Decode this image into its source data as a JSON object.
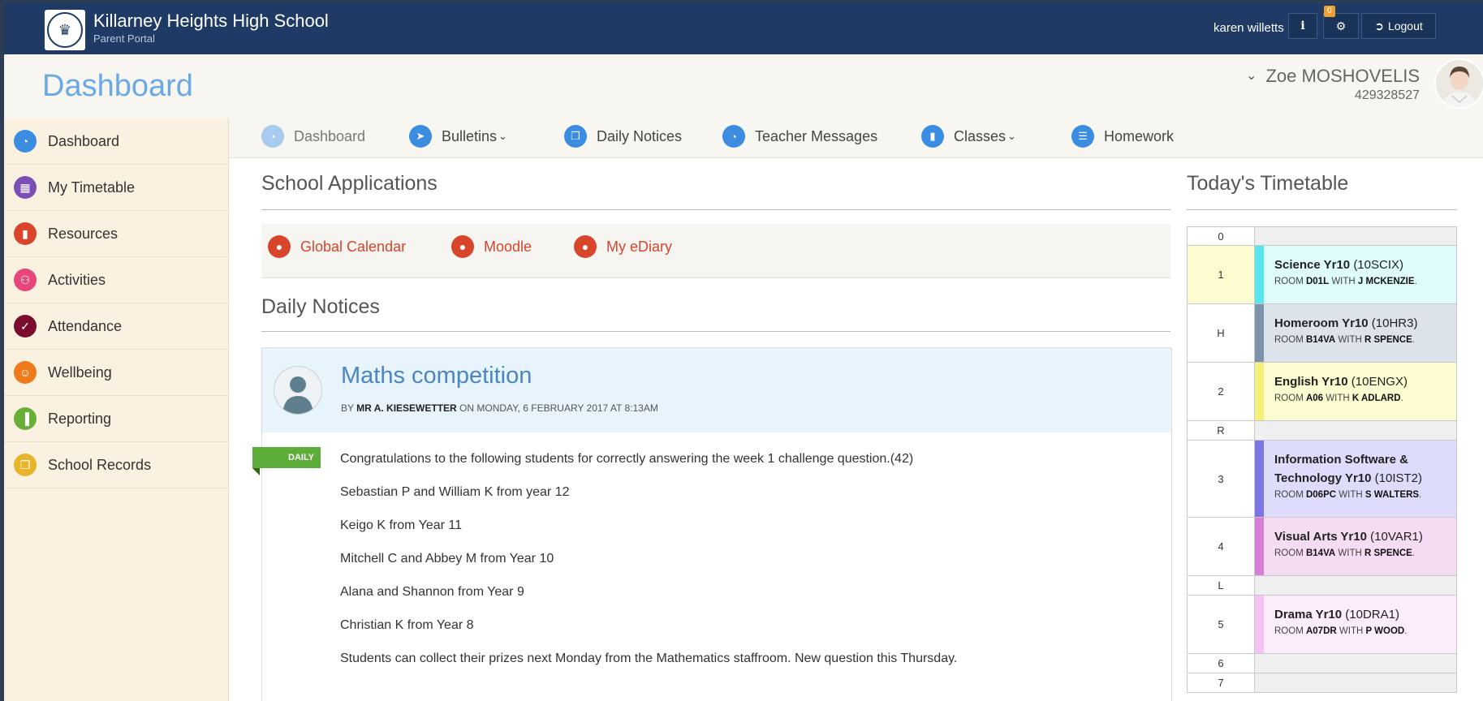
{
  "school": {
    "name": "Killarney Heights High School",
    "portal": "Parent Portal"
  },
  "topbar": {
    "user": "karen willetts",
    "info_icon": "i",
    "gear_badge": "0",
    "logout_label": "Logout"
  },
  "header": {
    "title": "Dashboard",
    "student_name": "Zoe MOSHOVELIS",
    "student_id": "429328527"
  },
  "sidebar": {
    "items": [
      {
        "label": "Dashboard",
        "icon": "dashboard-icon",
        "color": "#3a8de0"
      },
      {
        "label": "My Timetable",
        "icon": "calendar-icon",
        "color": "#7a4fb5"
      },
      {
        "label": "Resources",
        "icon": "book-icon",
        "color": "#d9452a"
      },
      {
        "label": "Activities",
        "icon": "bicycle-icon",
        "color": "#e8457a"
      },
      {
        "label": "Attendance",
        "icon": "check-icon",
        "color": "#7a0d2e"
      },
      {
        "label": "Wellbeing",
        "icon": "smile-icon",
        "color": "#f07a1a"
      },
      {
        "label": "Reporting",
        "icon": "bar-chart-icon",
        "color": "#6aae3a"
      },
      {
        "label": "School Records",
        "icon": "files-icon",
        "color": "#e8b52a"
      }
    ]
  },
  "nav": {
    "dashboard": "Dashboard",
    "bulletins": "Bulletins",
    "daily_notices": "Daily Notices",
    "teacher_messages": "Teacher Messages",
    "classes": "Classes",
    "homework": "Homework"
  },
  "main": {
    "apps_title": "School Applications",
    "apps": [
      "Global Calendar",
      "Moodle",
      "My eDiary"
    ],
    "notices_title": "Daily Notices"
  },
  "notice": {
    "title": "Maths competition",
    "by": "BY",
    "author": "MR A. KIESEWETTER",
    "date": "ON MONDAY, 6 FEBRUARY 2017 AT 8:13AM",
    "tag": "DAILY",
    "lines": [
      "Congratulations to the following students for correctly answering the week 1 challenge question.(42)",
      "Sebastian P and William K from year 12",
      "Keigo K from Year 11",
      "Mitchell C and Abbey M from Year 10",
      "Alana and Shannon from Year 9",
      "Christian K from Year 8",
      "Students can collect their prizes next Monday from the Mathematics staffroom. New question this Thursday."
    ]
  },
  "timetable": {
    "title": "Today's Timetable",
    "room_word": "ROOM",
    "with_word": "WITH",
    "rows": [
      {
        "period": "0",
        "empty": true
      },
      {
        "period": "1",
        "subject": "Science Yr10",
        "code": "(10SCIX)",
        "room": "D01L",
        "teacher": "J MCKENZIE",
        "bg": "#dffcfd",
        "strip": "#5ae6ef",
        "pbg": "#fdfbd0"
      },
      {
        "period": "H",
        "subject": "Homeroom Yr10",
        "code": "(10HR3)",
        "room": "B14VA",
        "teacher": "R SPENCE",
        "bg": "#dde3ea",
        "strip": "#7d93ab",
        "pbg": "#ffffff"
      },
      {
        "period": "2",
        "subject": "English Yr10",
        "code": "(10ENGX)",
        "room": "A06",
        "teacher": "K ADLARD",
        "bg": "#fdfbd0",
        "strip": "#f5f07a",
        "pbg": "#ffffff"
      },
      {
        "period": "R",
        "empty": true
      },
      {
        "period": "3",
        "subject": "Information Software & Technology Yr10",
        "code": "(10IST2)",
        "room": "D06PC",
        "teacher": "S WALTERS",
        "bg": "#dedcfb",
        "strip": "#7b75e6",
        "pbg": "#ffffff"
      },
      {
        "period": "4",
        "subject": "Visual Arts Yr10",
        "code": "(10VAR1)",
        "room": "B14VA",
        "teacher": "R SPENCE",
        "bg": "#f5dcf3",
        "strip": "#d77fd6",
        "pbg": "#ffffff"
      },
      {
        "period": "L",
        "empty": true
      },
      {
        "period": "5",
        "subject": "Drama Yr10",
        "code": "(10DRA1)",
        "room": "A07DR",
        "teacher": "P WOOD",
        "bg": "#fcecfc",
        "strip": "#f7c3f4",
        "pbg": "#ffffff"
      },
      {
        "period": "6",
        "empty": true
      },
      {
        "period": "7",
        "empty": true
      }
    ]
  }
}
